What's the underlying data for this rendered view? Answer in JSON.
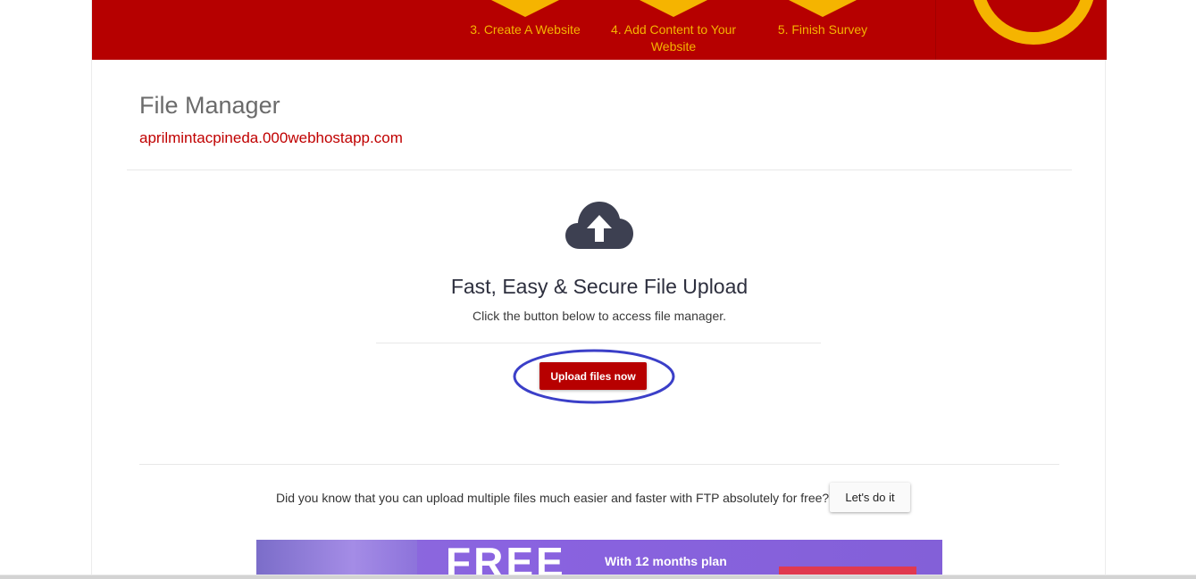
{
  "banner": {
    "steps": [
      {
        "label": "3. Create A Website"
      },
      {
        "label": "4. Add Content to Your Website"
      },
      {
        "label": "5. Finish Survey"
      }
    ]
  },
  "header": {
    "title": "File Manager",
    "domain": "aprilmintacpineda.000webhostapp.com"
  },
  "upload": {
    "icon": "cloud-upload-icon",
    "title": "Fast, Easy & Secure File Upload",
    "subtitle": "Click the button below to access file manager.",
    "button_label": "Upload files now"
  },
  "ftp": {
    "text": "Did you know that you can upload multiple files much easier and faster with FTP absolutely for free?",
    "button_label": "Let's do it"
  },
  "promo": {
    "headline": "FREE",
    "plan_text": "With 12 months plan"
  },
  "colors": {
    "brand_red": "#b60000",
    "accent_yellow": "#f5b400",
    "highlight_blue": "#3b3fc8"
  }
}
